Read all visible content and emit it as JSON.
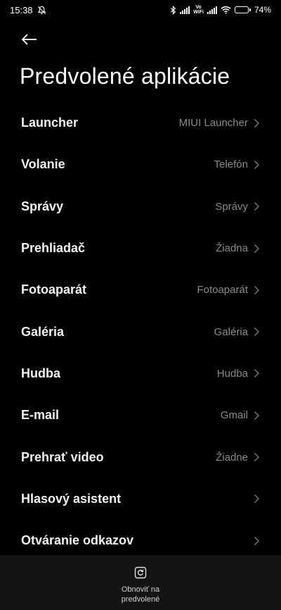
{
  "status_bar": {
    "time": "15:38",
    "battery_percent": "74",
    "battery_level": 0.74,
    "vowifi_top": "Vo",
    "vowifi_bottom": "WiFi",
    "icons": [
      "mute-bell-icon",
      "bluetooth-icon",
      "signal-icon",
      "vowifi-icon",
      "signal-icon",
      "wifi-icon",
      "battery-icon"
    ]
  },
  "header": {
    "back_icon": "arrow-left-icon",
    "title": "Predvolené aplikácie"
  },
  "items": [
    {
      "label": "Launcher",
      "value": "MIUI Launcher"
    },
    {
      "label": "Volanie",
      "value": "Telefón"
    },
    {
      "label": "Správy",
      "value": "Správy"
    },
    {
      "label": "Prehliadač",
      "value": "Žiadna"
    },
    {
      "label": "Fotoaparát",
      "value": "Fotoaparát"
    },
    {
      "label": "Galéria",
      "value": "Galéria"
    },
    {
      "label": "Hudba",
      "value": "Hudba"
    },
    {
      "label": "E-mail",
      "value": "Gmail"
    },
    {
      "label": "Prehrať video",
      "value": "Žiadne"
    },
    {
      "label": "Hlasový asistent",
      "value": ""
    },
    {
      "label": "Otváranie odkazov",
      "value": ""
    }
  ],
  "bottom": {
    "reset_icon": "reset-icon",
    "reset_label": "Obnoviť na predvolené"
  },
  "colors": {
    "background": "#000000",
    "bottom_bar": "#141414",
    "secondary_text": "#8a8a8a"
  }
}
